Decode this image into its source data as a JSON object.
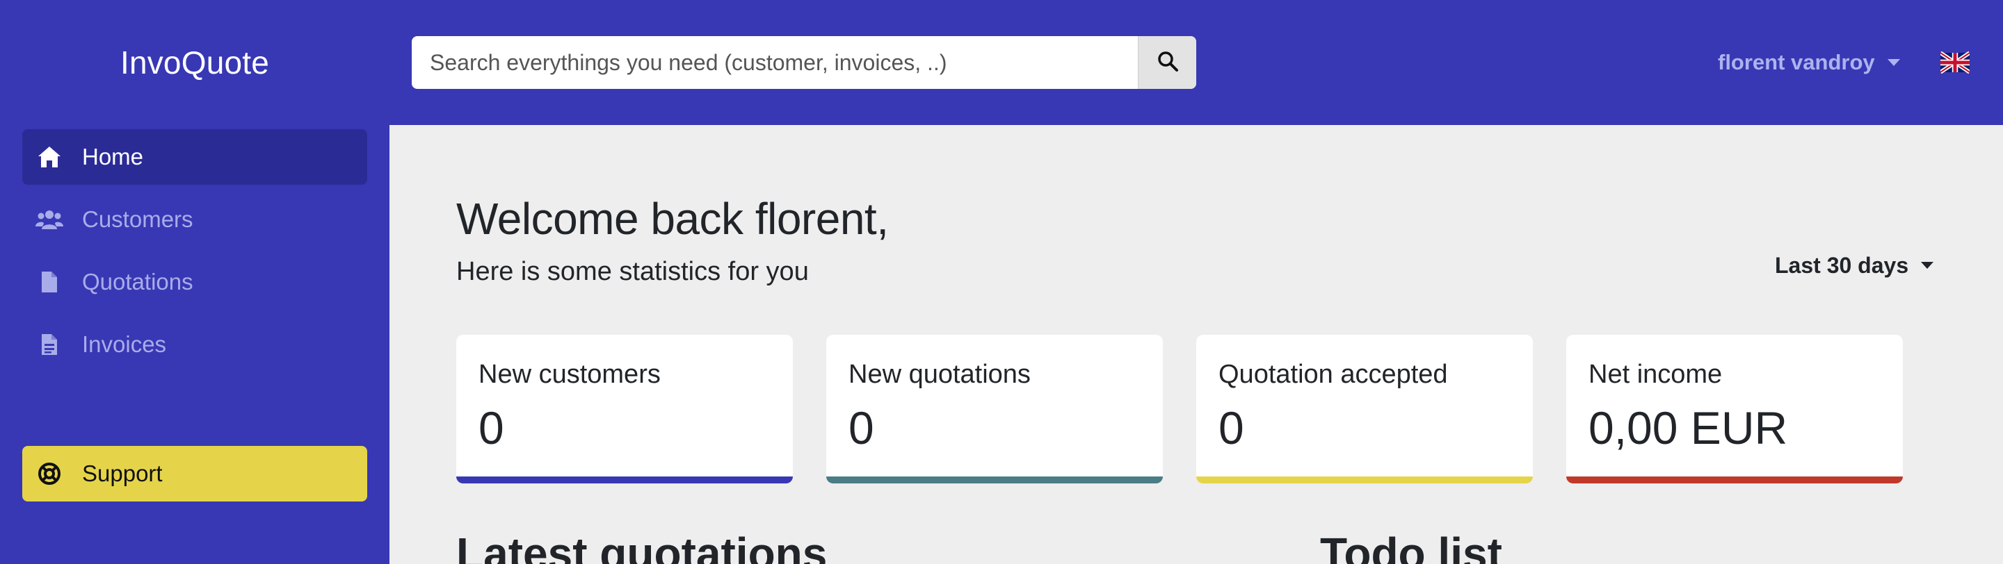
{
  "app": {
    "brand": "InvoQuote"
  },
  "sidebar": {
    "items": [
      {
        "label": "Home",
        "icon": "home-icon",
        "active": true
      },
      {
        "label": "Customers",
        "icon": "users-icon",
        "active": false
      },
      {
        "label": "Quotations",
        "icon": "file-icon",
        "active": false
      },
      {
        "label": "Invoices",
        "icon": "file-lines-icon",
        "active": false
      }
    ],
    "support_label": "Support"
  },
  "header": {
    "search_placeholder": "Search everythings you need (customer, invoices, ..)",
    "search_value": "",
    "user_name": "florent vandroy",
    "language_flag": "uk-flag-icon"
  },
  "main": {
    "welcome": "Welcome back florent,",
    "subtitle": "Here is some statistics for you",
    "period": "Last 30 days",
    "cards": [
      {
        "label": "New customers",
        "value": "0",
        "color": "#3838b4"
      },
      {
        "label": "New quotations",
        "value": "0",
        "color": "#4a7d85"
      },
      {
        "label": "Quotation accepted",
        "value": "0",
        "color": "#e5d44a"
      },
      {
        "label": "Net income",
        "value": "0,00 EUR",
        "color": "#c0392b"
      }
    ],
    "latest_quotations_title": "Latest quotations",
    "todo_title": "Todo list"
  },
  "colors": {
    "brand": "#3838b4",
    "brand_dark": "#2b2b96",
    "support": "#e5d44a",
    "background": "#eeeeee"
  }
}
